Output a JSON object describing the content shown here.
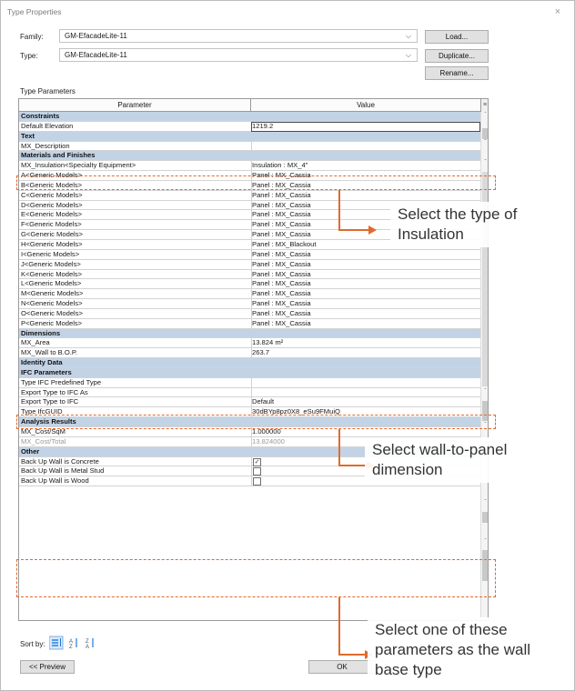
{
  "window": {
    "title": "Type Properties",
    "close_glyph": "×"
  },
  "family": {
    "label": "Family:",
    "value": "GM-EfacadeLite-11"
  },
  "type": {
    "label": "Type:",
    "value": "GM-EfacadeLite-11"
  },
  "buttons": {
    "load": "Load...",
    "duplicate": "Duplicate...",
    "rename": "Rename...",
    "preview": "<< Preview",
    "ok": "OK"
  },
  "type_parameters_label": "Type Parameters",
  "grid_header": {
    "parameter": "Parameter",
    "value": "Value"
  },
  "rows": [
    {
      "kind": "group",
      "p": "Constraints"
    },
    {
      "p": "Default Elevation",
      "v": "1219.2",
      "edit": true
    },
    {
      "kind": "group",
      "p": "Text"
    },
    {
      "p": "MX_Description",
      "v": ""
    },
    {
      "kind": "group",
      "p": "Materials and Finishes"
    },
    {
      "p": "MX_Insulation<Specialty Equipment>",
      "v": "Insulation : MX_4\""
    },
    {
      "p": "A<Generic Models>",
      "v": "Panel : MX_Cassia"
    },
    {
      "p": "B<Generic Models>",
      "v": "Panel : MX_Cassia"
    },
    {
      "p": "C<Generic Models>",
      "v": "Panel : MX_Cassia"
    },
    {
      "p": "D<Generic Models>",
      "v": "Panel : MX_Cassia"
    },
    {
      "p": "E<Generic Models>",
      "v": "Panel : MX_Cassia"
    },
    {
      "p": "F<Generic Models>",
      "v": "Panel : MX_Cassia"
    },
    {
      "p": "G<Generic Models>",
      "v": "Panel : MX_Cassia"
    },
    {
      "p": "H<Generic Models>",
      "v": "Panel : MX_Blackout"
    },
    {
      "p": "I<Generic Models>",
      "v": "Panel : MX_Cassia"
    },
    {
      "p": "J<Generic Models>",
      "v": "Panel : MX_Cassia"
    },
    {
      "p": "K<Generic Models>",
      "v": "Panel : MX_Cassia"
    },
    {
      "p": "L<Generic Models>",
      "v": "Panel : MX_Cassia"
    },
    {
      "p": "M<Generic Models>",
      "v": "Panel : MX_Cassia"
    },
    {
      "p": "N<Generic Models>",
      "v": "Panel : MX_Cassia"
    },
    {
      "p": "O<Generic Models>",
      "v": "Panel : MX_Cassia"
    },
    {
      "p": "P<Generic Models>",
      "v": "Panel : MX_Cassia"
    },
    {
      "kind": "group",
      "p": "Dimensions"
    },
    {
      "p": "MX_Area",
      "v": "13.824 m²"
    },
    {
      "p": "MX_Wall to B.O.P.",
      "v": "263.7"
    },
    {
      "kind": "group",
      "p": "Identity Data"
    },
    {
      "kind": "group",
      "p": "IFC Parameters"
    },
    {
      "p": "Type IFC Predefined Type",
      "v": ""
    },
    {
      "p": "Export Type to IFC As",
      "v": ""
    },
    {
      "p": "Export Type to IFC",
      "v": "Default"
    },
    {
      "p": "Type IfcGUID",
      "v": "30dBYp8pz0X8_eSu9FMuiQ"
    },
    {
      "kind": "group",
      "p": "Analysis Results"
    },
    {
      "p": "MX_Cost/SqM",
      "v": "1.000000"
    },
    {
      "p": "MX_Cost/Total",
      "v": "13.824000",
      "disabled": true
    },
    {
      "kind": "group",
      "p": "Other"
    },
    {
      "p": "Back Up Wall is Concrete",
      "check": "✓"
    },
    {
      "p": "Back Up Wall is Metal Stud",
      "check": ""
    },
    {
      "p": "Back Up Wall is Wood",
      "check": ""
    }
  ],
  "sort_by": {
    "label": "Sort by:",
    "icons": [
      "grouped-sort-icon",
      "sort-ascending-icon",
      "sort-descending-icon"
    ]
  },
  "annotations": {
    "insulation": "Select the type of Insulation",
    "wall_to_panel": "Select wall-to-panel dimension",
    "base_type": "Select one of these parameters as the wall base type"
  },
  "colors": {
    "accent_dash": "#e06a2c",
    "group_row": "#c3d3e6",
    "sort_icon": "#1e7bd6"
  }
}
